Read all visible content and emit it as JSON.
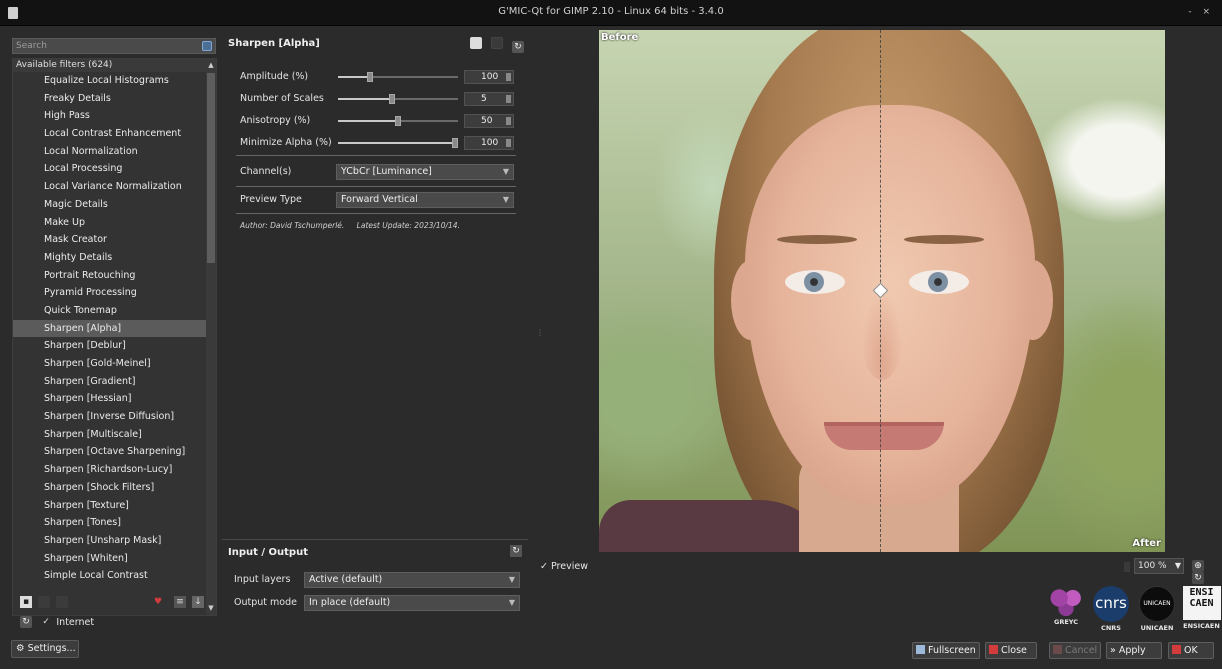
{
  "window": {
    "title": "G'MIC-Qt for GIMP 2.10 - Linux 64 bits - 3.4.0",
    "controls": "- ×"
  },
  "search": {
    "placeholder": "Search"
  },
  "filters": {
    "header": "Available filters (624)",
    "items": [
      "Equalize Local Histograms",
      "Freaky Details",
      "High Pass",
      "Local Contrast Enhancement",
      "Local Normalization",
      "Local Processing",
      "Local Variance Normalization",
      "Magic Details",
      "Make Up",
      "Mask Creator",
      "Mighty Details",
      "Portrait Retouching",
      "Pyramid Processing",
      "Quick Tonemap",
      "Sharpen [Alpha]",
      "Sharpen [Deblur]",
      "Sharpen [Gold-Meinel]",
      "Sharpen [Gradient]",
      "Sharpen [Hessian]",
      "Sharpen [Inverse Diffusion]",
      "Sharpen [Multiscale]",
      "Sharpen [Octave Sharpening]",
      "Sharpen [Richardson-Lucy]",
      "Sharpen [Shock Filters]",
      "Sharpen [Texture]",
      "Sharpen [Tones]",
      "Sharpen [Unsharp Mask]",
      "Sharpen [Whiten]",
      "Simple Local Contrast"
    ],
    "selected_index": 14
  },
  "internet": {
    "label": "Internet",
    "checked": true
  },
  "settings_label": "Settings...",
  "filter_panel": {
    "title": "Sharpen [Alpha]",
    "params": [
      {
        "label": "Amplitude (%)",
        "value": "100",
        "fraction": 0.27
      },
      {
        "label": "Number of Scales",
        "value": "5",
        "fraction": 0.45
      },
      {
        "label": "Anisotropy (%)",
        "value": "50",
        "fraction": 0.5
      },
      {
        "label": "Minimize Alpha (%)",
        "value": "100",
        "fraction": 1.0
      }
    ],
    "channels": {
      "label": "Channel(s)",
      "value": "YCbCr [Luminance]"
    },
    "preview_type": {
      "label": "Preview Type",
      "value": "Forward Vertical"
    },
    "author": "Author: David Tschumperlé.",
    "latest_update": "Latest Update: 2023/10/14."
  },
  "io": {
    "title": "Input / Output",
    "input_layers": {
      "label": "Input layers",
      "value": "Active (default)"
    },
    "output_mode": {
      "label": "Output mode",
      "value": "In place (default)"
    }
  },
  "preview": {
    "before_label": "Before",
    "after_label": "After",
    "checkbox_label": "Preview",
    "zoom": "100 %"
  },
  "logos": [
    {
      "caption": "GREYC",
      "mark": ""
    },
    {
      "caption": "CNRS",
      "mark": "cnrs"
    },
    {
      "caption": "UNICAEN",
      "mark": "UNICAEN"
    },
    {
      "caption": "ENSICAEN",
      "mark": "ENSI CAEN"
    }
  ],
  "buttons": {
    "fullscreen": "Fullscreen",
    "close": "Close",
    "cancel": "Cancel",
    "apply": "Apply",
    "ok": "OK"
  },
  "colors": {
    "background": "#2b2b2b",
    "list_bg": "#333333",
    "selected": "#5b5b5b",
    "accent_red": "#d23c3c"
  }
}
